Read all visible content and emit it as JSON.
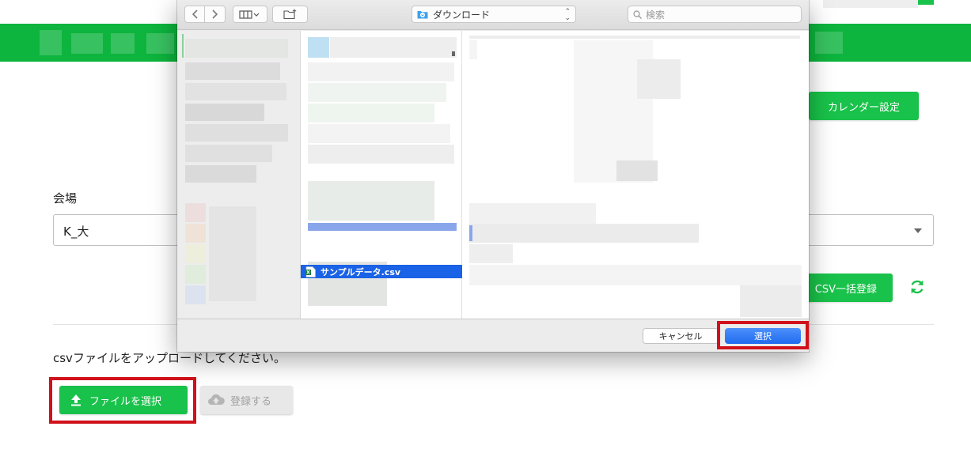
{
  "page": {
    "calendar_button": "カレンダー設定",
    "venue_label": "会場",
    "venue_value": "K_大",
    "csv_bulk_button": "CSV一括登録",
    "upload_instruction": "csvファイルをアップロードしてください。",
    "file_select_button": "ファイルを選択",
    "register_button": "登録する"
  },
  "dialog": {
    "location": "ダウンロード",
    "search_placeholder": "検索",
    "selected_file": "サンプルデータ.csv",
    "cancel_button": "キャンセル",
    "select_button": "選択"
  },
  "colors": {
    "brand_green": "#0db43d",
    "highlight_red": "#d0111b",
    "finder_selection": "#1a62e6"
  }
}
